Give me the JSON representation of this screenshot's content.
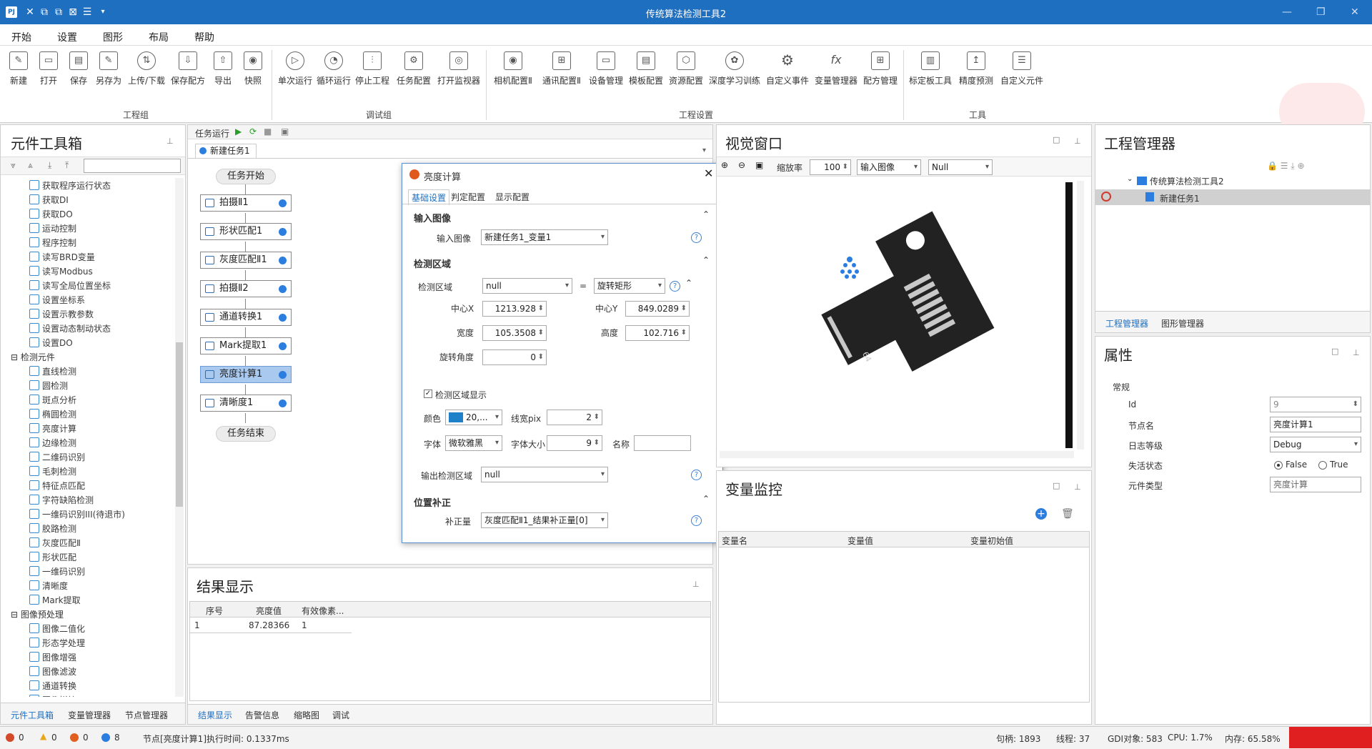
{
  "titlebar": {
    "title": "传统算法检测工具2",
    "app_icon": "PJ"
  },
  "menu": [
    "开始",
    "设置",
    "图形",
    "布局",
    "帮助"
  ],
  "ribbon": {
    "buttons": [
      "新建",
      "打开",
      "保存",
      "另存为",
      "上传/下载",
      "保存配方",
      "导出",
      "快照",
      "单次运行",
      "循环运行",
      "停止工程",
      "任务配置",
      "打开监视器",
      "相机配置Ⅱ",
      "通讯配置Ⅱ",
      "设备管理",
      "模板配置",
      "资源配置",
      "深度学习训练",
      "自定义事件",
      "变量管理器",
      "配方管理",
      "标定板工具",
      "精度预测",
      "自定义元件"
    ],
    "groups": [
      "工程组",
      "调试组",
      "工程设置",
      "工具"
    ]
  },
  "toolbox": {
    "title": "元件工具箱",
    "items_a": [
      "获取程序运行状态",
      "获取DI",
      "获取DO",
      "运动控制",
      "程序控制",
      "读写BRD变量",
      "读写Modbus",
      "读写全局位置坐标",
      "设置坐标系",
      "设置示教参数",
      "设置动态制动状态",
      "设置DO"
    ],
    "cat_detect": "检测元件",
    "items_b": [
      "直线检测",
      "圆检测",
      "斑点分析",
      "椭圆检测",
      "亮度计算",
      "边缘检测",
      "二维码识别",
      "毛刺检测",
      "特征点匹配",
      "字符缺陷检测",
      "一维码识别III(待退市)",
      "胶路检测",
      "灰度匹配Ⅱ",
      "形状匹配",
      "一维码识别",
      "清晰度",
      "Mark提取"
    ],
    "cat_pre": "图像预处理",
    "items_c": [
      "图像二值化",
      "形态学处理",
      "图像增强",
      "图像滤波",
      "通道转换",
      "图像拼接"
    ],
    "tabs": [
      "元件工具箱",
      "变量管理器",
      "节点管理器"
    ]
  },
  "task": {
    "toolbar_label": "任务运行",
    "tab": "新建任务1",
    "start": "任务开始",
    "end": "任务结束",
    "nodes": [
      "拍摄Ⅱ1",
      "形状匹配1",
      "灰度匹配Ⅱ1",
      "拍摄Ⅱ2",
      "通道转换1",
      "Mark提取1",
      "亮度计算1",
      "清晰度1"
    ]
  },
  "dialog": {
    "title": "亮度计算",
    "tabs": [
      "基础设置",
      "判定配置",
      "显示配置"
    ],
    "sec_input": "输入图像",
    "input_label": "输入图像",
    "input_value": "新建任务1_变量1",
    "sec_region": "检测区域",
    "region_label": "检测区域",
    "region_value": "null",
    "eq": "=",
    "shape_value": "旋转矩形",
    "cx_label": "中心X",
    "cx": "1213.928",
    "cy_label": "中心Y",
    "cy": "849.0289",
    "w_label": "宽度",
    "w": "105.3508",
    "h_label": "高度",
    "h": "102.716",
    "angle_label": "旋转角度",
    "angle": "0",
    "show_region": "检测区域显示",
    "color_label": "颜色",
    "color_value": "20,...",
    "line_label": "线宽pix",
    "line": "2",
    "font_label": "字体",
    "font_value": "微软雅黑",
    "fsize_label": "字体大小",
    "fsize": "9",
    "name_label": "名称",
    "name": "",
    "out_label": "输出检测区域",
    "out_value": "null",
    "sec_pos": "位置补正",
    "comp_label": "补正量",
    "comp_value": "灰度匹配Ⅱ1_结果补正量[0]"
  },
  "result": {
    "title": "结果显示",
    "headers": [
      "序号",
      "亮度值",
      "有效像素..."
    ],
    "rows": [
      [
        "1",
        "87.28366",
        "1"
      ]
    ],
    "tabs": [
      "结果显示",
      "告警信息",
      "缩略图",
      "调试"
    ]
  },
  "view": {
    "title": "视觉窗口",
    "zoom_label": "缩放率",
    "zoom": "100",
    "src": "输入图像",
    "null": "Null"
  },
  "var": {
    "title": "变量监控",
    "headers": [
      "变量名",
      "变量值",
      "变量初始值"
    ]
  },
  "project": {
    "title": "工程管理器",
    "root": "传统算法检测工具2",
    "child": "新建任务1",
    "tabs": [
      "工程管理器",
      "图形管理器"
    ]
  },
  "props": {
    "title": "属性",
    "section": "常规",
    "id_label": "Id",
    "id": "9",
    "node_label": "节点名",
    "node": "亮度计算1",
    "log_label": "日志等级",
    "log": "Debug",
    "fail_label": "失活状态",
    "false": "False",
    "true": "True",
    "type_label": "元件类型",
    "type": "亮度计算"
  },
  "status": {
    "err": "0",
    "warn": "0",
    "stop": "0",
    "info": "8",
    "message": "节点[亮度计算1]执行时间: 0.1337ms",
    "handle": "句柄: 1893",
    "thread": "线程: 37",
    "gdi": "GDI对象: 583",
    "cpu": "CPU: 1.7%",
    "mem": "内存: 65.58%"
  },
  "colors": {
    "accent": "#1f6fc0",
    "region": "#2b7de0"
  }
}
